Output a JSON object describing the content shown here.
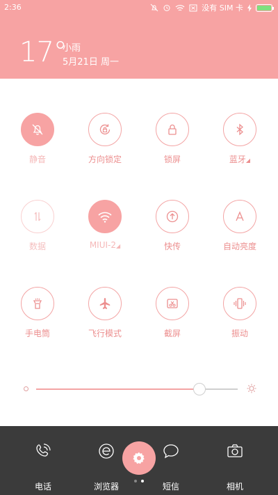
{
  "status_bar": {
    "time": "2:36",
    "carrier_text": "没有 SIM 卡",
    "battery_level": 1.0,
    "icons": [
      "mute-icon",
      "alarm-icon",
      "wifi-icon",
      "sim-missing-icon",
      "charging-icon",
      "battery-icon"
    ]
  },
  "weather": {
    "temperature": "17°",
    "condition": "小雨",
    "date": "5月21日 周一"
  },
  "toggles": [
    {
      "label": "静音",
      "icon": "mute-icon",
      "active": true
    },
    {
      "label": "方向锁定",
      "icon": "rotation-lock-icon",
      "active": false
    },
    {
      "label": "锁屏",
      "icon": "lock-icon",
      "active": false
    },
    {
      "label": "蓝牙",
      "icon": "bluetooth-icon",
      "active": false
    },
    {
      "label": "数据",
      "icon": "mobile-data-icon",
      "active": false
    },
    {
      "label": "MIUI-2",
      "icon": "wifi-icon",
      "active": true
    },
    {
      "label": "快传",
      "icon": "quick-transfer-icon",
      "active": false
    },
    {
      "label": "自动亮度",
      "icon": "auto-brightness-icon",
      "active": false
    },
    {
      "label": "手电筒",
      "icon": "flashlight-icon",
      "active": false
    },
    {
      "label": "飞行模式",
      "icon": "airplane-icon",
      "active": false
    },
    {
      "label": "截屏",
      "icon": "screenshot-icon",
      "active": false
    },
    {
      "label": "振动",
      "icon": "vibrate-icon",
      "active": false
    }
  ],
  "brightness": {
    "level": 0.81
  },
  "dock": {
    "items": [
      {
        "label": "电话",
        "icon": "phone-icon"
      },
      {
        "label": "浏览器",
        "icon": "browser-icon"
      },
      {
        "label": "短信",
        "icon": "message-icon"
      },
      {
        "label": "相机",
        "icon": "camera-icon"
      }
    ],
    "settings_icon": "gear-icon",
    "page_count": 2,
    "current_page": 2
  },
  "colors": {
    "accent": "#f7a3a3",
    "accent_text": "#ec8f8f",
    "dock_bg": "#3b3b3b"
  }
}
